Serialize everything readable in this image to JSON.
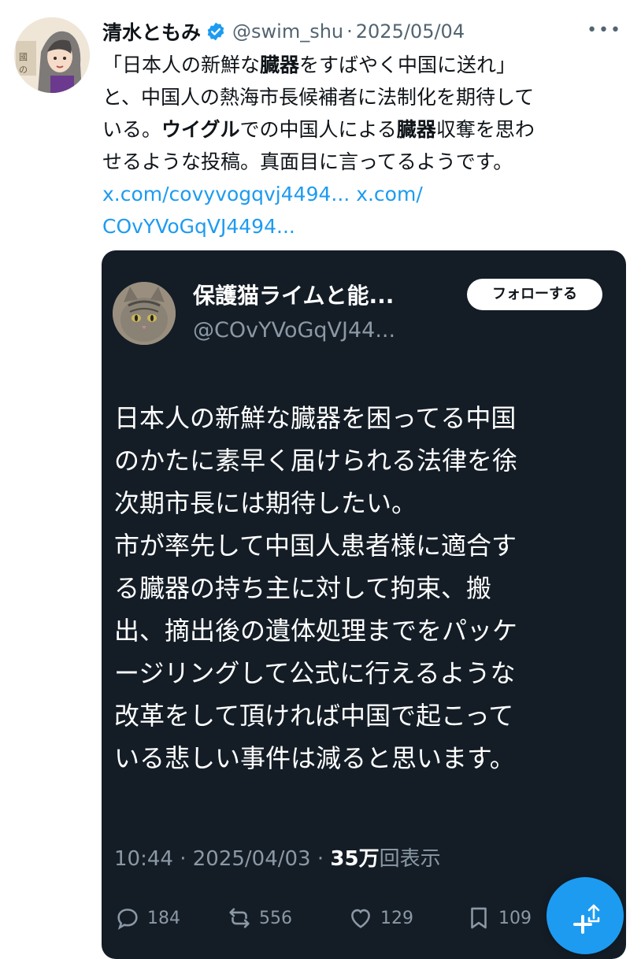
{
  "tweet": {
    "author_name": "清水ともみ",
    "handle": "@swim_shu",
    "separator": "·",
    "date": "2025/05/04",
    "more_label": "•••",
    "text_line_1": "「日本人の新鮮な",
    "text_bold_1": "臓器",
    "text_line_1b": "をすばやく中国に送れ」",
    "text_line_2": "と、中国人の熱海市長候補者に法制化を期待して",
    "text_line_3a": "いる。",
    "text_bold_2": "ウイグル",
    "text_line_3b": "での中国人による",
    "text_bold_3": "臓器",
    "text_line_3c": "収奪を思わ",
    "text_line_4": "せるような投稿。真面目に言ってるようです。",
    "link_1": "x.com/covyvogqvj4494...",
    "link_2a": "x.com/",
    "link_2b": "COvYVoGqVJ4494..."
  },
  "quoted": {
    "name": "保護猫ライムと能...",
    "handle": "@COvYVoGqVJ44...",
    "follow_label": "フォローする",
    "text_lines": [
      "日本人の新鮮な臓器を困ってる中国",
      "のかたに素早く届けられる法律を徐",
      "次期市長には期待したい。",
      "市が率先して中国人患者様に適合す",
      "る臓器の持ち主に対して拘束、搬",
      "出、摘出後の遺体処理までをパッケ",
      "ージリングして公式に行えるような",
      "改革をして頂ければ中国で起こって",
      "いる悲しい事件は減ると思います。"
    ],
    "time": "10:44",
    "sep": "·",
    "date": "2025/04/03",
    "sep2": "·",
    "views_num": "35万",
    "views_label": "回表示",
    "replies": "184",
    "reposts": "556",
    "likes": "129",
    "bookmarks": "109"
  },
  "colors": {
    "link": "#1d9bf0",
    "card_bg": "#141d26",
    "muted": "#536471",
    "fab": "#1d9bf0"
  },
  "icons": [
    "verified-badge-icon",
    "more-icon",
    "reply-icon",
    "repost-icon",
    "like-icon",
    "bookmark-icon",
    "compose-plus-icon",
    "share-icon"
  ]
}
